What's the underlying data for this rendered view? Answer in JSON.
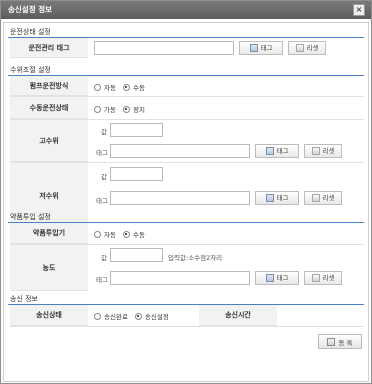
{
  "window": {
    "title": "송신설정 정보",
    "close_glyph": "×"
  },
  "sections": {
    "operation": {
      "title": "운전상태 설정",
      "row_label": "운전관리 태그"
    },
    "level": {
      "title": "수위조절 설정",
      "pump_mode_label": "펌프운전방식",
      "manual_state_label": "수동운전상태",
      "high_label": "고수위",
      "low_label": "저수위"
    },
    "chemical": {
      "title": "약품투입 설정",
      "dosing_label": "약품투입기",
      "conc_label": "농도",
      "conc_hint": "입력값:소수점2자리"
    },
    "send": {
      "title": "송신 정보",
      "state_label": "송신상태",
      "time_label": "송신시간"
    }
  },
  "common": {
    "tag_button": "태그",
    "reset_button": "리셋",
    "value_label": "값",
    "tag_label": "태그"
  },
  "radios": {
    "auto": "자동",
    "manual": "수동",
    "run": "가동",
    "stop": "정지",
    "send_done": "송신완료",
    "send_set": "송신설정"
  },
  "footer": {
    "register_button": "등 록"
  },
  "icons": [
    "tag-icon",
    "reset-icon",
    "register-icon",
    "close-icon"
  ]
}
